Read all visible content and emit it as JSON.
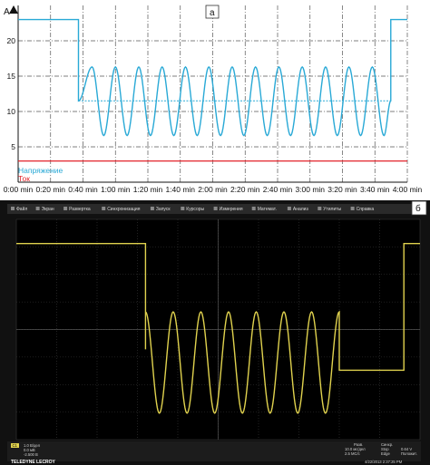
{
  "chart_data": [
    {
      "type": "line",
      "panel_label": "а",
      "ylabel": "A",
      "ylim": [
        0,
        25
      ],
      "y_ticks": [
        "5",
        "10",
        "15",
        "20"
      ],
      "y_tick_values": [
        5,
        10,
        15,
        20
      ],
      "xlim": [
        0,
        4
      ],
      "x_ticks": [
        "0:00 min",
        "0:20 min",
        "0:40 min",
        "1:00 min",
        "1:20 min",
        "1:40 min",
        "2:00 min",
        "2:20 min",
        "2:40 min",
        "3:00 min",
        "3:20 min",
        "3:40 min",
        "4:00 min"
      ],
      "grid": true,
      "legend_position": "bottom-left",
      "series": [
        {
          "name": "Напряжение",
          "color": "#29a9d6",
          "x": [
            0.0,
            0.62,
            0.62,
            0.76,
            0.88,
            1.0,
            1.12,
            1.24,
            1.36,
            1.48,
            1.6,
            1.72,
            1.84,
            1.96,
            2.08,
            2.2,
            2.32,
            2.44,
            2.56,
            2.68,
            2.8,
            2.92,
            3.04,
            3.16,
            3.28,
            3.4,
            3.52,
            3.64,
            3.76,
            3.83,
            3.83,
            4.0
          ],
          "y": [
            23,
            23,
            11.5,
            16.3,
            6.6,
            16.3,
            6.6,
            16.3,
            6.6,
            16.3,
            6.6,
            16.3,
            6.6,
            16.3,
            6.6,
            16.3,
            6.6,
            16.3,
            6.6,
            16.3,
            6.6,
            16.3,
            6.6,
            16.3,
            6.6,
            16.3,
            6.6,
            16.3,
            6.6,
            11.5,
            23,
            23
          ]
        },
        {
          "name": "Ток",
          "color": "#e3242b",
          "x": [
            0.0,
            4.0
          ],
          "y": [
            3,
            3
          ]
        }
      ],
      "annotations": {
        "dotted_level": 11.5,
        "dotted_range": [
          0.62,
          3.83
        ]
      }
    },
    {
      "type": "line",
      "panel_label": "б",
      "trace_color": "#e0d24e",
      "waveform": {
        "high_level": 0.55,
        "low_level": 1.24,
        "cycles": 7,
        "amplitude": 1.1,
        "offset_level": 0.4,
        "step_times": [
          0.32,
          0.34,
          0.89,
          0.96
        ]
      },
      "menu": [
        "Файл",
        "Экран",
        "Развертка",
        "Синхронизация",
        "Запуск",
        "Курсоры",
        "Измерения",
        "Математ.",
        "Анализ",
        "Утилиты",
        "Справка"
      ],
      "channel": {
        "label": "C1",
        "lines": [
          "1.0 В/дел",
          "0.0 мВ",
          "-2.500 В"
        ]
      },
      "timebase": {
        "title": "Разв.",
        "lines": [
          "10.0 мс/дел",
          "2.5 МС/с"
        ],
        "trigger_title": "Синхр.",
        "trigger_lines": [
          "Stop",
          "Edge",
          "0.64 V",
          "Положит."
        ]
      },
      "brand": "TELEDYNE LECROY",
      "timestamp": "4/22/2013 2:37:25 PM"
    }
  ]
}
